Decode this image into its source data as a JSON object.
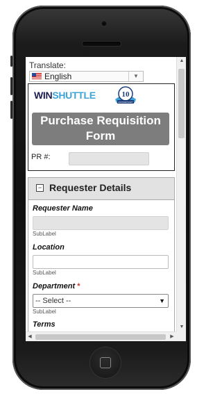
{
  "translate": {
    "label": "Translate:",
    "language": "English",
    "flag_icon": "us-flag-icon"
  },
  "brand": {
    "logo_win": "WIN",
    "logo_shuttle": "SHUTTLE",
    "badge_number": "10",
    "badge_text": "ANNIVERSARY",
    "colors": {
      "win": "#1b1d4f",
      "shuttle": "#3da3d9"
    }
  },
  "form": {
    "title": "Purchase Requisition Form",
    "pr_label": "PR #:",
    "pr_value": ""
  },
  "section": {
    "title": "Requester Details",
    "collapse_symbol": "−",
    "fields": {
      "requester_name": {
        "label": "Requester Name",
        "value": "",
        "sublabel": "SubLabel"
      },
      "location": {
        "label": "Location",
        "value": "",
        "sublabel": "SubLabel"
      },
      "department": {
        "label": "Department",
        "required_mark": "*",
        "selected": "-- Select --",
        "sublabel": "SubLabel"
      },
      "terms": {
        "label": "Terms"
      }
    }
  },
  "scrollbar": {
    "up": "▲",
    "down": "▼",
    "left": "◀",
    "right": "▶",
    "dropdown_arrow": "▼"
  }
}
